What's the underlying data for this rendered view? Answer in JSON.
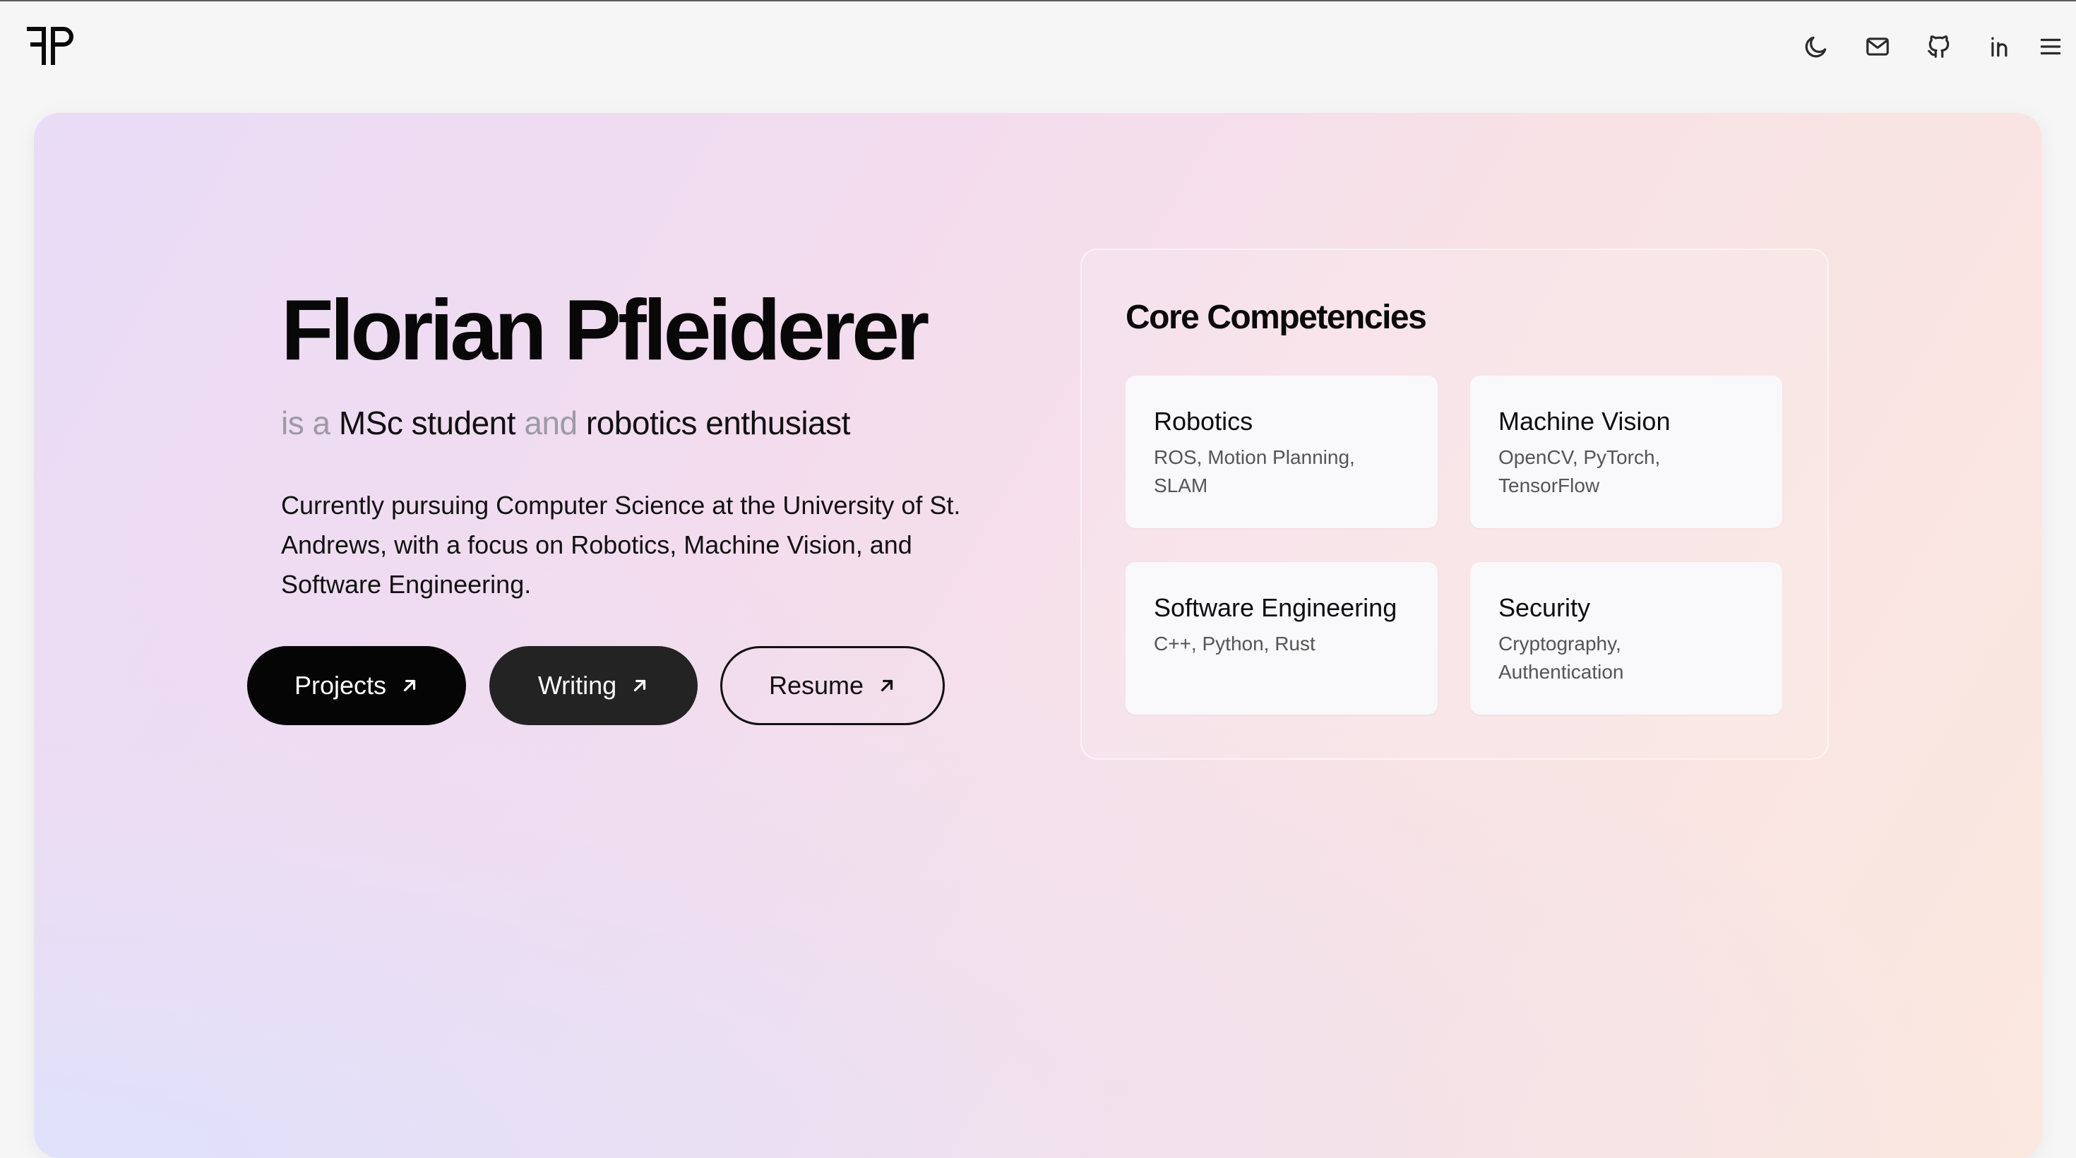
{
  "header": {
    "logo_text": "FP",
    "icons": [
      "moon-icon",
      "mail-icon",
      "github-icon",
      "linkedin-icon",
      "menu-icon"
    ]
  },
  "hero": {
    "name": "Florian Pfleiderer",
    "tagline": {
      "part1": "is a ",
      "role": "MSc student",
      "part2": " and ",
      "interest": "robotics enthusiast"
    },
    "description": "Currently pursuing Computer Science at the University of St. Andrews, with a focus on Robotics, Machine Vision, and Software Engineering.",
    "buttons": {
      "projects": "Projects",
      "writing": "Writing",
      "resume": "Resume"
    }
  },
  "competencies": {
    "title": "Core Competencies",
    "items": [
      {
        "title": "Robotics",
        "subtitle": "ROS, Motion Planning, SLAM"
      },
      {
        "title": "Machine Vision",
        "subtitle": "OpenCV, PyTorch, TensorFlow"
      },
      {
        "title": "Software Engineering",
        "subtitle": "C++, Python, Rust"
      },
      {
        "title": "Security",
        "subtitle": "Cryptography, Authentication"
      }
    ]
  },
  "colors": {
    "primary_button": "#050505",
    "secondary_button": "#232323",
    "muted_text": "#9d9aa3"
  }
}
